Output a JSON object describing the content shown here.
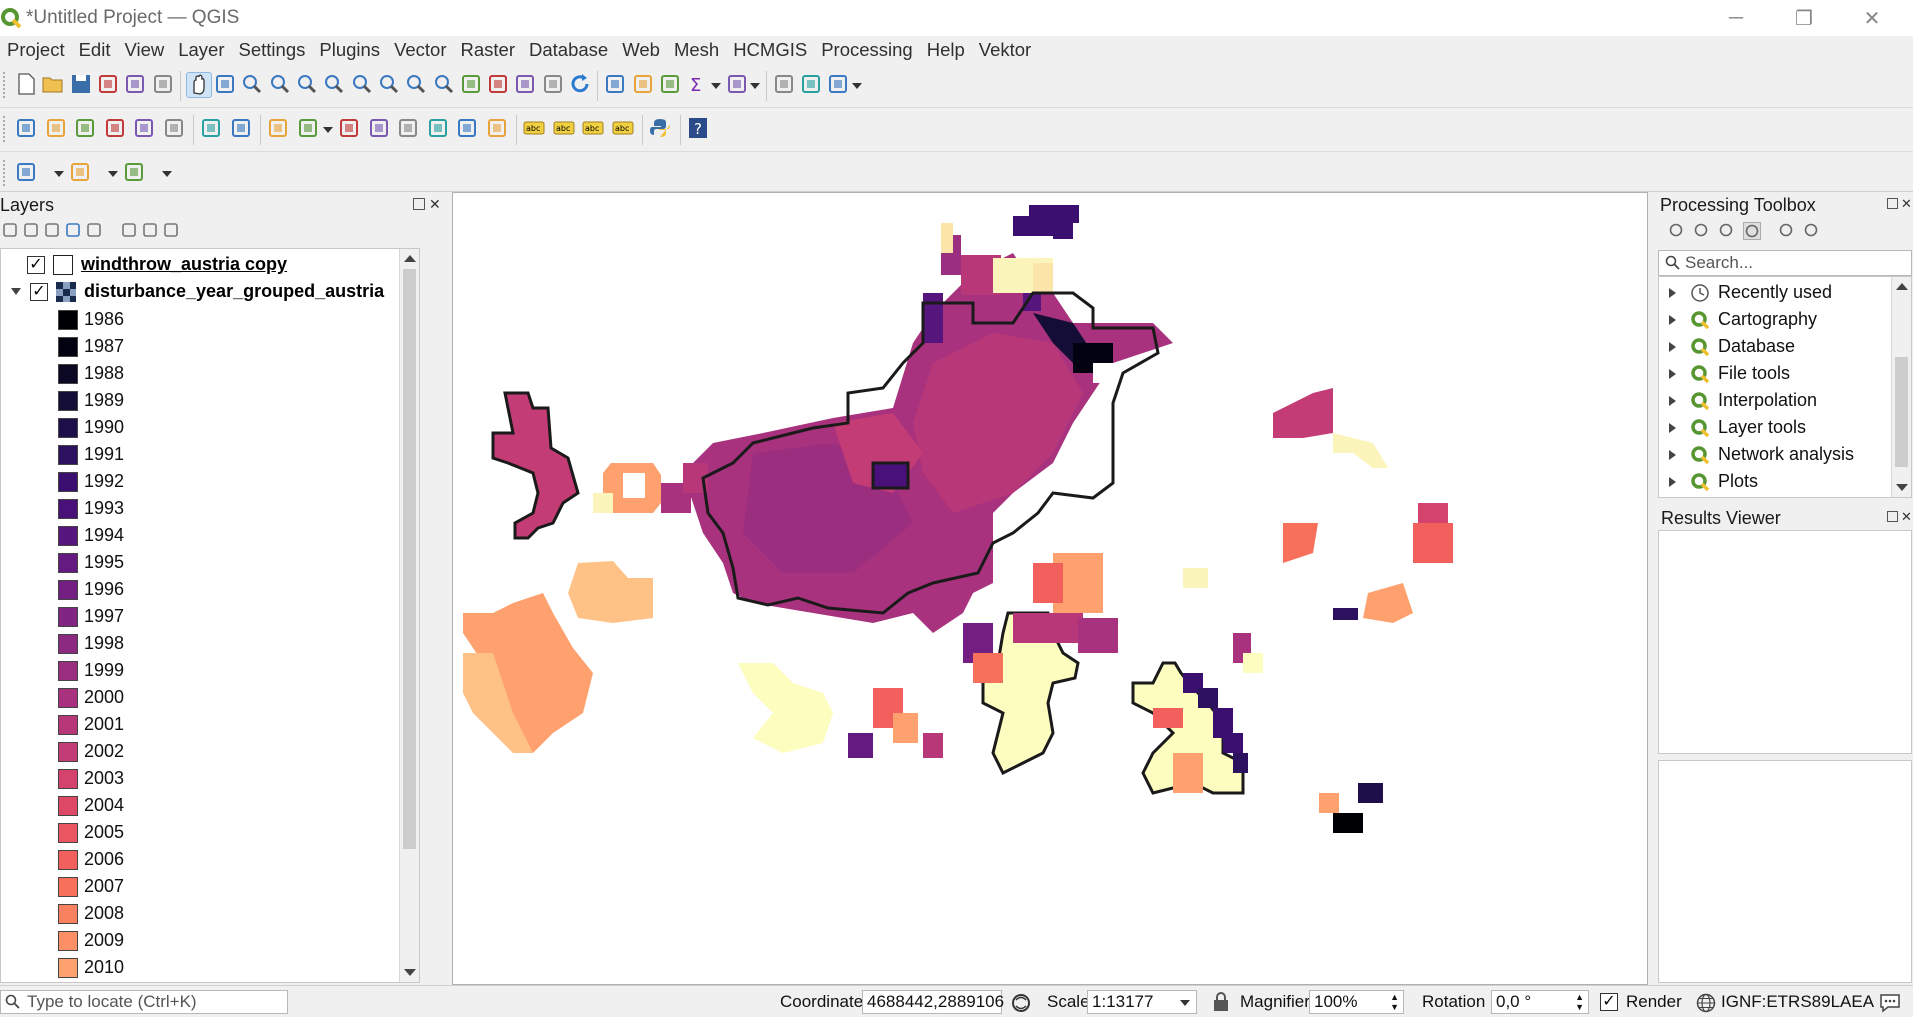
{
  "window": {
    "title": "*Untitled Project — QGIS"
  },
  "menu": [
    "Project",
    "Edit",
    "View",
    "Layer",
    "Settings",
    "Plugins",
    "Vector",
    "Raster",
    "Database",
    "Web",
    "Mesh",
    "HCMGIS",
    "Processing",
    "Help",
    "Vektor"
  ],
  "layers_panel": {
    "title": "Layers",
    "layers": [
      {
        "name": "windthrow_austria copy",
        "checked": true,
        "symbol": "polygon-outline"
      },
      {
        "name": "disturbance_year_grouped_austria",
        "checked": true,
        "symbol": "raster"
      }
    ],
    "legend": [
      {
        "label": "1986",
        "color": "#000004"
      },
      {
        "label": "1987",
        "color": "#030210"
      },
      {
        "label": "1988",
        "color": "#0a0822"
      },
      {
        "label": "1989",
        "color": "#140e36"
      },
      {
        "label": "1990",
        "color": "#1e0f4b"
      },
      {
        "label": "1991",
        "color": "#2c115f"
      },
      {
        "label": "1992",
        "color": "#3b0f70"
      },
      {
        "label": "1993",
        "color": "#4a1079"
      },
      {
        "label": "1994",
        "color": "#57157e"
      },
      {
        "label": "1995",
        "color": "#641a80"
      },
      {
        "label": "1996",
        "color": "#721f81"
      },
      {
        "label": "1997",
        "color": "#802582"
      },
      {
        "label": "1998",
        "color": "#8c2981"
      },
      {
        "label": "1999",
        "color": "#9b2e7f"
      },
      {
        "label": "2000",
        "color": "#a8327d"
      },
      {
        "label": "2001",
        "color": "#b73779"
      },
      {
        "label": "2002",
        "color": "#c43c75"
      },
      {
        "label": "2003",
        "color": "#d3436e"
      },
      {
        "label": "2004",
        "color": "#de4968"
      },
      {
        "label": "2005",
        "color": "#ea5661"
      },
      {
        "label": "2006",
        "color": "#f1605d"
      },
      {
        "label": "2007",
        "color": "#f7705c"
      },
      {
        "label": "2008",
        "color": "#fa815f"
      },
      {
        "label": "2009",
        "color": "#fc8f65"
      },
      {
        "label": "2010",
        "color": "#fea16e"
      }
    ]
  },
  "processing_toolbox": {
    "title": "Processing Toolbox",
    "search_placeholder": "Search...",
    "items": [
      "Recently used",
      "Cartography",
      "Database",
      "File tools",
      "Interpolation",
      "Layer tools",
      "Network analysis",
      "Plots"
    ]
  },
  "results_viewer": {
    "title": "Results Viewer"
  },
  "statusbar": {
    "locate_placeholder": "Type to locate (Ctrl+K)",
    "coordinate_label": "Coordinate",
    "coordinate_value": "4688442,2889106",
    "scale_label": "Scale",
    "scale_value": "1:13177",
    "magnifier_label": "Magnifier",
    "magnifier_value": "100%",
    "rotation_label": "Rotation",
    "rotation_value": "0,0 °",
    "render_label": "Render",
    "render_checked": true,
    "crs": "IGNF:ETRS89LAEA"
  },
  "colors": {
    "accent": "#589632",
    "selection": "#cfe3f7",
    "outline": "#1a1a1a"
  },
  "icons": {
    "toolbar1": [
      "new-project-icon",
      "open-project-icon",
      "save-project-icon",
      "save-as-icon",
      "print-layout-icon",
      "style-manager-icon",
      "pan-icon",
      "pan-to-selection-icon",
      "zoom-in-icon",
      "zoom-out-icon",
      "zoom-full-icon",
      "zoom-selection-icon",
      "zoom-layer-icon",
      "zoom-native-icon",
      "zoom-last-icon",
      "zoom-next-icon",
      "new-map-view-icon",
      "new-bookmark-icon",
      "show-bookmarks-icon",
      "temporal-controller-icon",
      "refresh-icon",
      "identify-icon",
      "attribute-table-icon",
      "field-calculator-icon",
      "statistics-icon",
      "measure-icon",
      "tips-icon",
      "map-tips-icon",
      "text-annotation-icon"
    ],
    "toolbar2": [
      "data-source-manager-icon",
      "new-geopackage-icon",
      "new-shapefile-icon",
      "digitize-icon",
      "edits-icon",
      "virtual-layer-icon",
      "toggle-editing-icon",
      "save-edits-icon",
      "add-feature-icon",
      "vertex-tool-icon",
      "delete-icon",
      "cut-icon",
      "copy-icon",
      "paste-icon",
      "undo-icon",
      "redo-icon",
      "label-icon",
      "pin-label-icon",
      "highlight-label-icon",
      "change-label-icon",
      "python-icon",
      "help-icon"
    ],
    "toolbar3": [
      "select-features-icon",
      "deselect-icon",
      "select-by-expression-icon"
    ]
  }
}
